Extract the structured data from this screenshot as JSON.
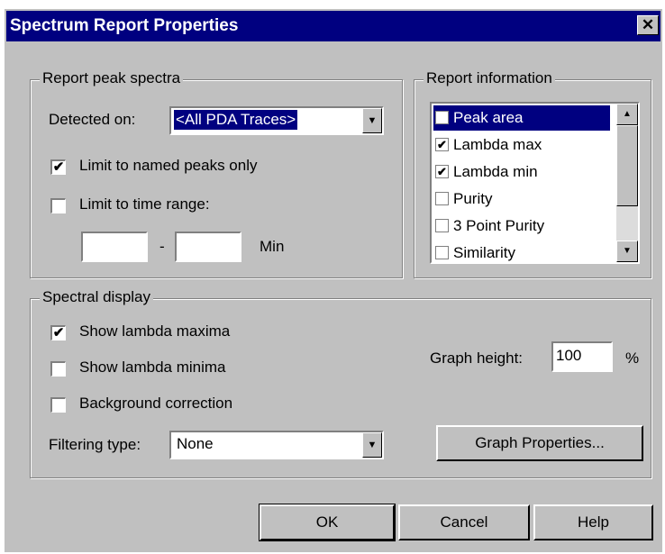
{
  "window": {
    "title": "Spectrum Report Properties",
    "close_glyph": "✕"
  },
  "report_peak_spectra": {
    "legend": "Report peak spectra",
    "detected_on_label": "Detected on:",
    "detected_on_value": "<All PDA Traces>",
    "limit_named_label": "Limit to named peaks only",
    "limit_named_checked": true,
    "limit_time_label": "Limit to time range:",
    "limit_time_checked": false,
    "time_from": "",
    "time_to": "",
    "separator": "-",
    "unit": "Min"
  },
  "report_information": {
    "legend": "Report information",
    "items": [
      {
        "label": "Peak area",
        "checked": false,
        "selected": true
      },
      {
        "label": "Lambda max",
        "checked": true,
        "selected": false
      },
      {
        "label": "Lambda min",
        "checked": true,
        "selected": false
      },
      {
        "label": "Purity",
        "checked": false,
        "selected": false
      },
      {
        "label": "3 Point Purity",
        "checked": false,
        "selected": false
      },
      {
        "label": "Similarity",
        "checked": false,
        "selected": false
      }
    ]
  },
  "spectral_display": {
    "legend": "Spectral display",
    "show_max_label": "Show lambda maxima",
    "show_max_checked": true,
    "show_min_label": "Show lambda minima",
    "show_min_checked": false,
    "background_label": "Background correction",
    "background_checked": false,
    "filtering_label": "Filtering type:",
    "filtering_value": "None",
    "graph_height_label": "Graph height:",
    "graph_height_value": "100",
    "graph_height_unit": "%",
    "graph_properties_label": "Graph Properties..."
  },
  "buttons": {
    "ok": "OK",
    "cancel": "Cancel",
    "help": "Help"
  },
  "glyphs": {
    "check": "✔",
    "down": "▼",
    "up": "▲"
  }
}
